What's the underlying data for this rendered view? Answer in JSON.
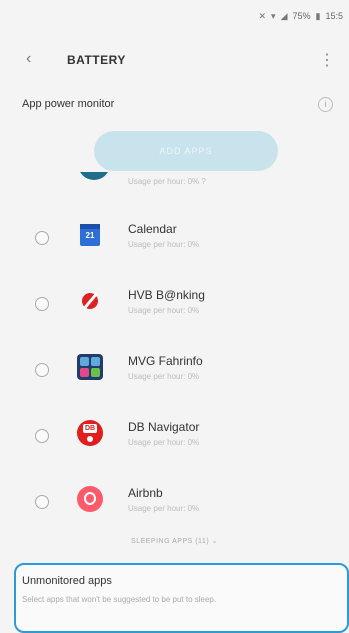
{
  "status_bar": {
    "icons": [
      "mute-icon",
      "wifi-icon",
      "signal-icon"
    ],
    "battery_text": "75%",
    "time": "15:5"
  },
  "app_bar": {
    "title": "BATTERY"
  },
  "section": {
    "title": "App power monitor"
  },
  "add_button": {
    "label": "ADD APPS"
  },
  "partial_app": {
    "usage": "Usage per hour: 0% ?"
  },
  "apps": [
    {
      "name": "Calendar",
      "usage": "Usage per hour: 0%",
      "icon": "calendar-icon"
    },
    {
      "name": "HVB B@nking",
      "usage": "Usage per hour: 0%",
      "icon": "hvb-icon"
    },
    {
      "name": "MVG Fahrinfo",
      "usage": "Usage per hour: 0%",
      "icon": "mvg-icon"
    },
    {
      "name": "DB Navigator",
      "usage": "Usage per hour: 0%",
      "icon": "db-icon"
    },
    {
      "name": "Airbnb",
      "usage": "Usage per hour: 0%",
      "icon": "airbnb-icon"
    }
  ],
  "sleeping_label": "SLEEPING APPS (11) ⌄",
  "unmonitored": {
    "title": "Unmonitored apps",
    "description": "Select apps that won't be suggested to be put to sleep."
  },
  "colors": {
    "accent": "#2e9ad8",
    "button_bg": "#c9e3ec"
  }
}
